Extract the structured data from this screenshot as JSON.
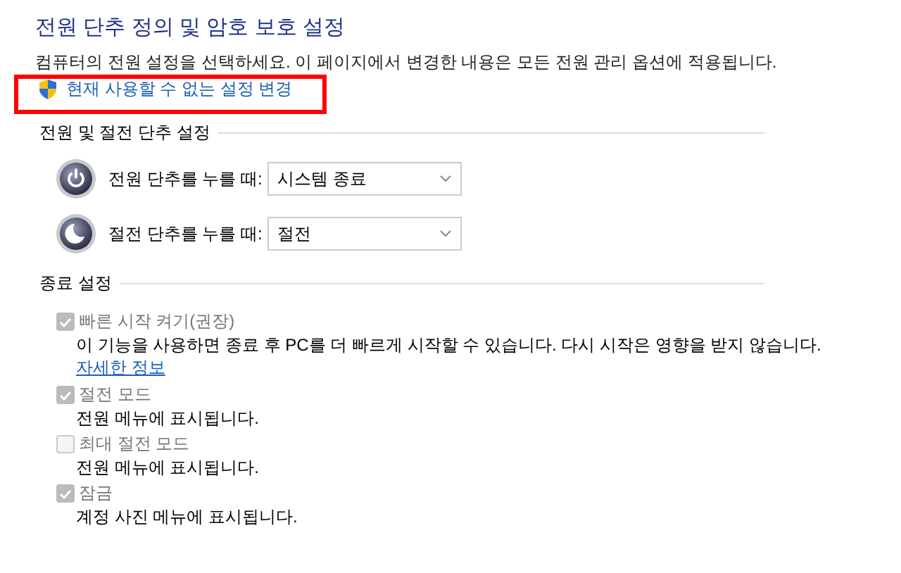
{
  "title": "전원 단추 정의 및 암호 보호 설정",
  "description": "컴퓨터의 전원 설정을 선택하세요. 이 페이지에서 변경한 내용은 모든 전원 관리 옵션에 적용됩니다.",
  "admin_link": "현재 사용할 수 없는 설정 변경",
  "highlight": {
    "color": "#ff0000"
  },
  "button_section": {
    "heading": "전원 및 절전 단추 설정",
    "rows": [
      {
        "kind": "power",
        "label": "전원 단추를 누를 때:",
        "value": "시스템 종료"
      },
      {
        "kind": "sleep",
        "label": "절전 단추를 누를 때:",
        "value": "절전"
      }
    ]
  },
  "shutdown_section": {
    "heading": "종료 설정",
    "options": [
      {
        "label": "빠른 시작 켜기(권장)",
        "checked": true,
        "disabled": true,
        "description": "이 기능을 사용하면 종료 후 PC를 더 빠르게 시작할 수 있습니다. 다시 시작은 영향을 받지 않습니다.",
        "link": "자세한 정보"
      },
      {
        "label": "절전 모드",
        "checked": true,
        "disabled": true,
        "description": "전원 메뉴에 표시됩니다."
      },
      {
        "label": "최대 절전 모드",
        "checked": false,
        "disabled": true,
        "description": "전원 메뉴에 표시됩니다."
      },
      {
        "label": "잠금",
        "checked": true,
        "disabled": true,
        "description": "계정 사진 메뉴에 표시됩니다."
      }
    ]
  }
}
